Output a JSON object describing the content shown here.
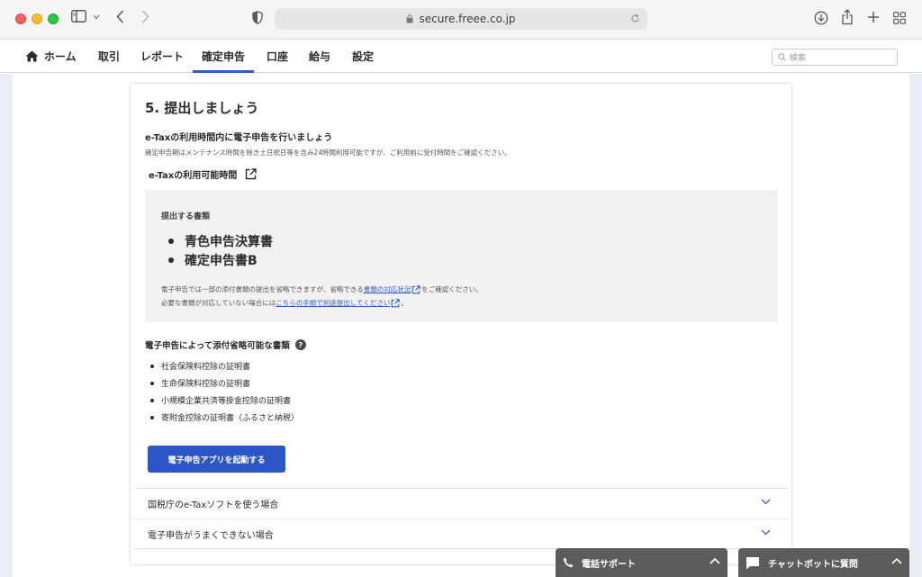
{
  "browser": {
    "url": "secure.freee.co.jp"
  },
  "nav": {
    "items": [
      {
        "label": "ホーム"
      },
      {
        "label": "取引"
      },
      {
        "label": "レポート"
      },
      {
        "label": "確定申告",
        "active": true
      },
      {
        "label": "口座"
      },
      {
        "label": "給与"
      },
      {
        "label": "設定"
      }
    ],
    "search_placeholder": "検索"
  },
  "card": {
    "step_title": "5.  提出しましょう",
    "section_title": "e-Taxの利用時間内に電子申告を行いましょう",
    "section_note": "確定申告期はメンテナンス時間を除き土日祝日等を含み24時間利用可能ですが、ご利用前に受付時間をご確認ください。",
    "availability_link": "e-Taxの利用可能時間",
    "docs": {
      "label": "提出する書類",
      "items": [
        "青色申告決算書",
        "確定申告書B"
      ],
      "note1_pre": "電子申告では一部の添付書類の提出を省略できますが、省略できる",
      "note1_link": "書類の対応状況",
      "note1_post": "をご確認ください。",
      "note2_pre": "必要な書類が対応していない場合には",
      "note2_link": "こちらの手順で別途提出してください",
      "note2_post": "。"
    },
    "omit": {
      "title": "電子申告によって添付省略可能な書類",
      "help": "?",
      "items": [
        "社会保険料控除の証明書",
        "生命保険料控除の証明書",
        "小規模企業共済等掛金控除の証明書",
        "寄附金控除の証明書（ふるさと納税）"
      ]
    },
    "launch_button": "電子申告アプリを起動する",
    "accordions": [
      "国税庁のe-Taxソフトを使う場合",
      "電子申告がうまくできない場合"
    ]
  },
  "support": {
    "phone": "電話サポート",
    "chatbot": "チャットボットに質問"
  }
}
